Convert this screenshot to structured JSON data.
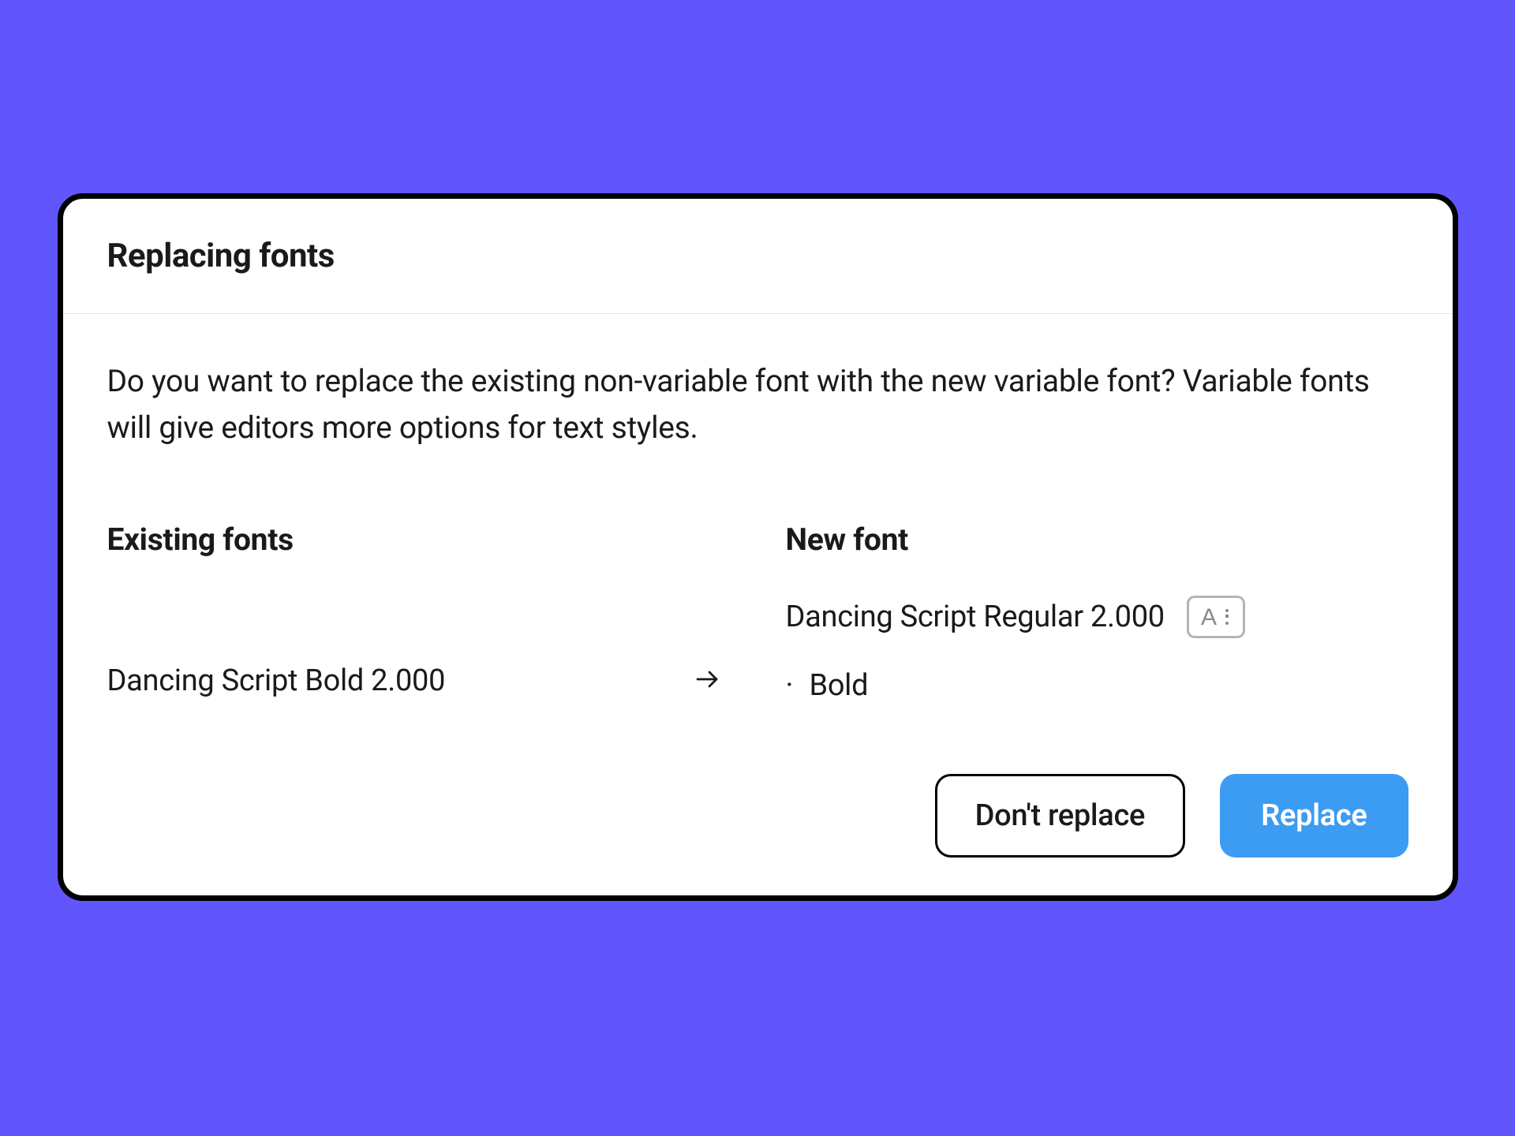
{
  "dialog": {
    "title": "Replacing fonts",
    "description": "Do you want to replace the existing non-variable font with the new variable font? Variable fonts will give editors more options for text styles.",
    "columns": {
      "existing_label": "Existing fonts",
      "new_label": "New font"
    },
    "existing_font": {
      "name": "Dancing Script Bold 2.000"
    },
    "new_font": {
      "name": "Dancing Script Regular 2.000",
      "variant": "Bold"
    },
    "buttons": {
      "secondary": "Don't replace",
      "primary": "Replace"
    }
  }
}
